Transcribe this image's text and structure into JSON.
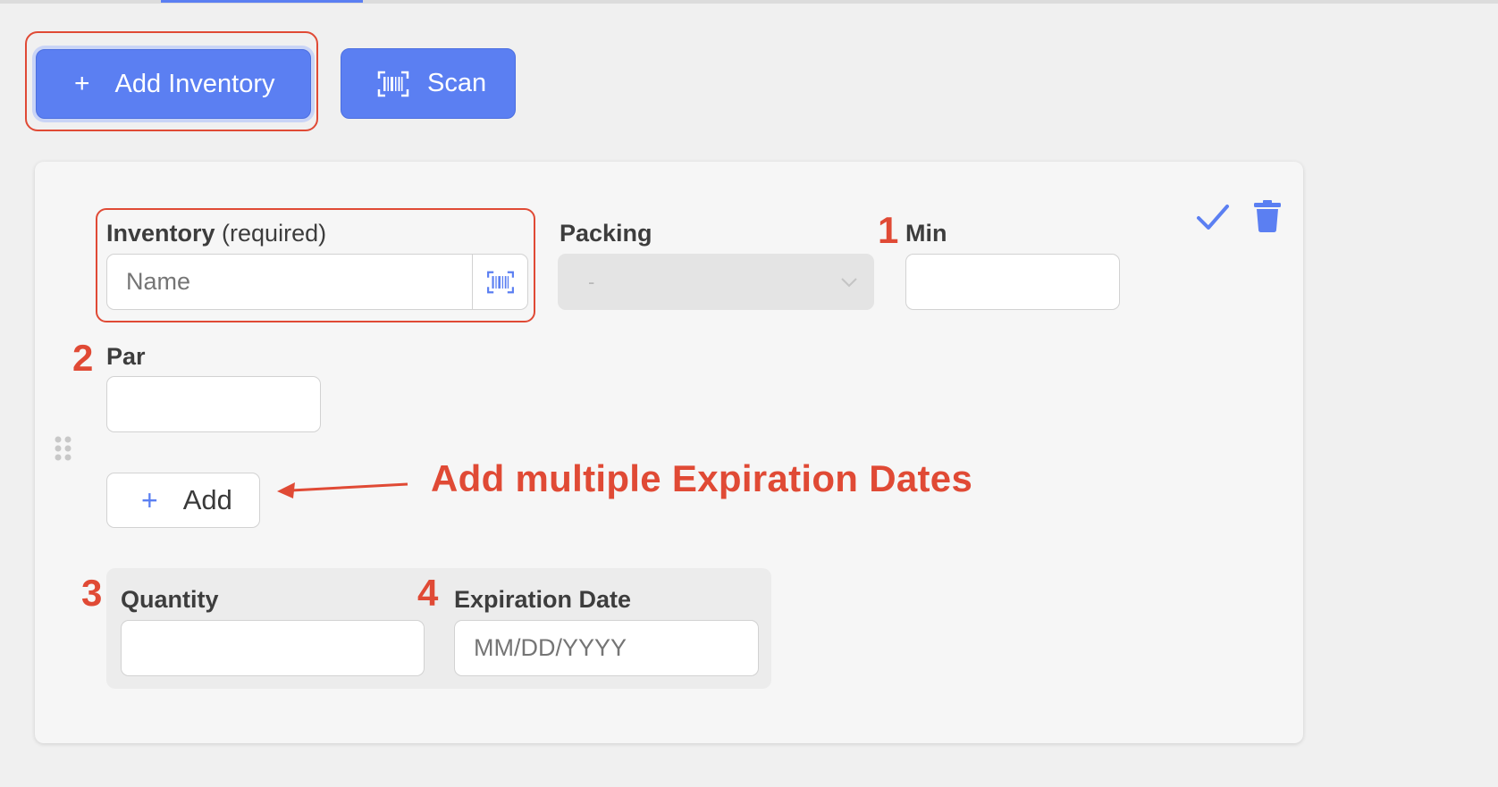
{
  "toolbar": {
    "add_inventory_plus": "+",
    "add_inventory_label": "Add Inventory",
    "scan_label": "Scan"
  },
  "form": {
    "inventory_label": "Inventory",
    "inventory_required": "(required)",
    "inventory_placeholder": "Name",
    "packing_label": "Packing",
    "packing_value": "-",
    "min_label": "Min",
    "par_label": "Par",
    "add_plus": "+",
    "add_label": "Add",
    "quantity_label": "Quantity",
    "expiration_label": "Expiration Date",
    "expiration_placeholder": "MM/DD/YYYY"
  },
  "annotations": {
    "n1": "1",
    "n2": "2",
    "n3": "3",
    "n4": "4",
    "callout": "Add multiple Expiration Dates"
  },
  "icons": {
    "scan": "barcode-scan-icon",
    "confirm": "check-icon",
    "delete": "trash-icon",
    "drag": "drag-handle-icon",
    "dropdown": "chevron-down-icon"
  },
  "colors": {
    "accent": "#5b7ff2",
    "annotation": "#e04a35",
    "background": "#f0f0f0",
    "card": "#f6f6f6"
  }
}
